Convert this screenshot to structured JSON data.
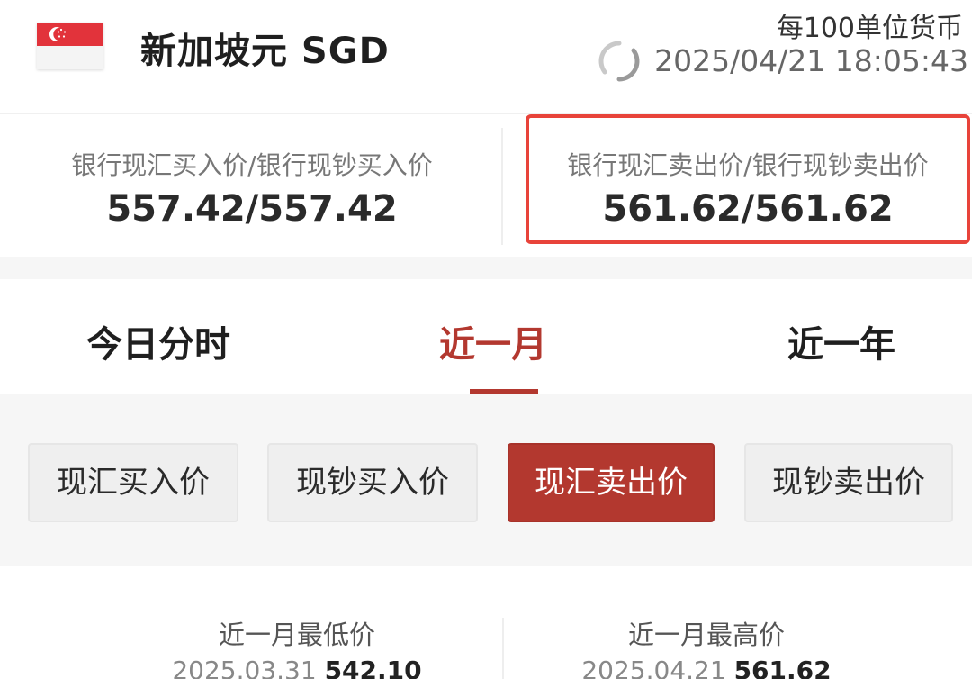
{
  "header": {
    "currency_name": "新加坡元 SGD",
    "unit_note": "每100单位货币",
    "timestamp": "2025/04/21 18:05:43",
    "flag_icon": "singapore-flag-icon",
    "refresh_icon": "refresh-icon"
  },
  "prices": {
    "buy_label": "银行现汇买入价/银行现钞买入价",
    "buy_value": "557.42/557.42",
    "sell_label": "银行现汇卖出价/银行现钞卖出价",
    "sell_value": "561.62/561.62",
    "highlight_color": "#e8433a"
  },
  "period_tabs": {
    "items": [
      {
        "label": "今日分时",
        "selected": false
      },
      {
        "label": "近一月",
        "selected": true
      },
      {
        "label": "近一年",
        "selected": false
      }
    ],
    "accent_color": "#b3382f"
  },
  "rate_types": {
    "items": [
      {
        "label": "现汇买入价",
        "selected": false
      },
      {
        "label": "现钞买入价",
        "selected": false
      },
      {
        "label": "现汇卖出价",
        "selected": true
      },
      {
        "label": "现钞卖出价",
        "selected": false
      }
    ]
  },
  "stats": {
    "low_label": "近一月最低价",
    "low_date": "2025.03.31",
    "low_value": "542.10",
    "high_label": "近一月最高价",
    "high_date": "2025.04.21",
    "high_value": "561.62"
  }
}
